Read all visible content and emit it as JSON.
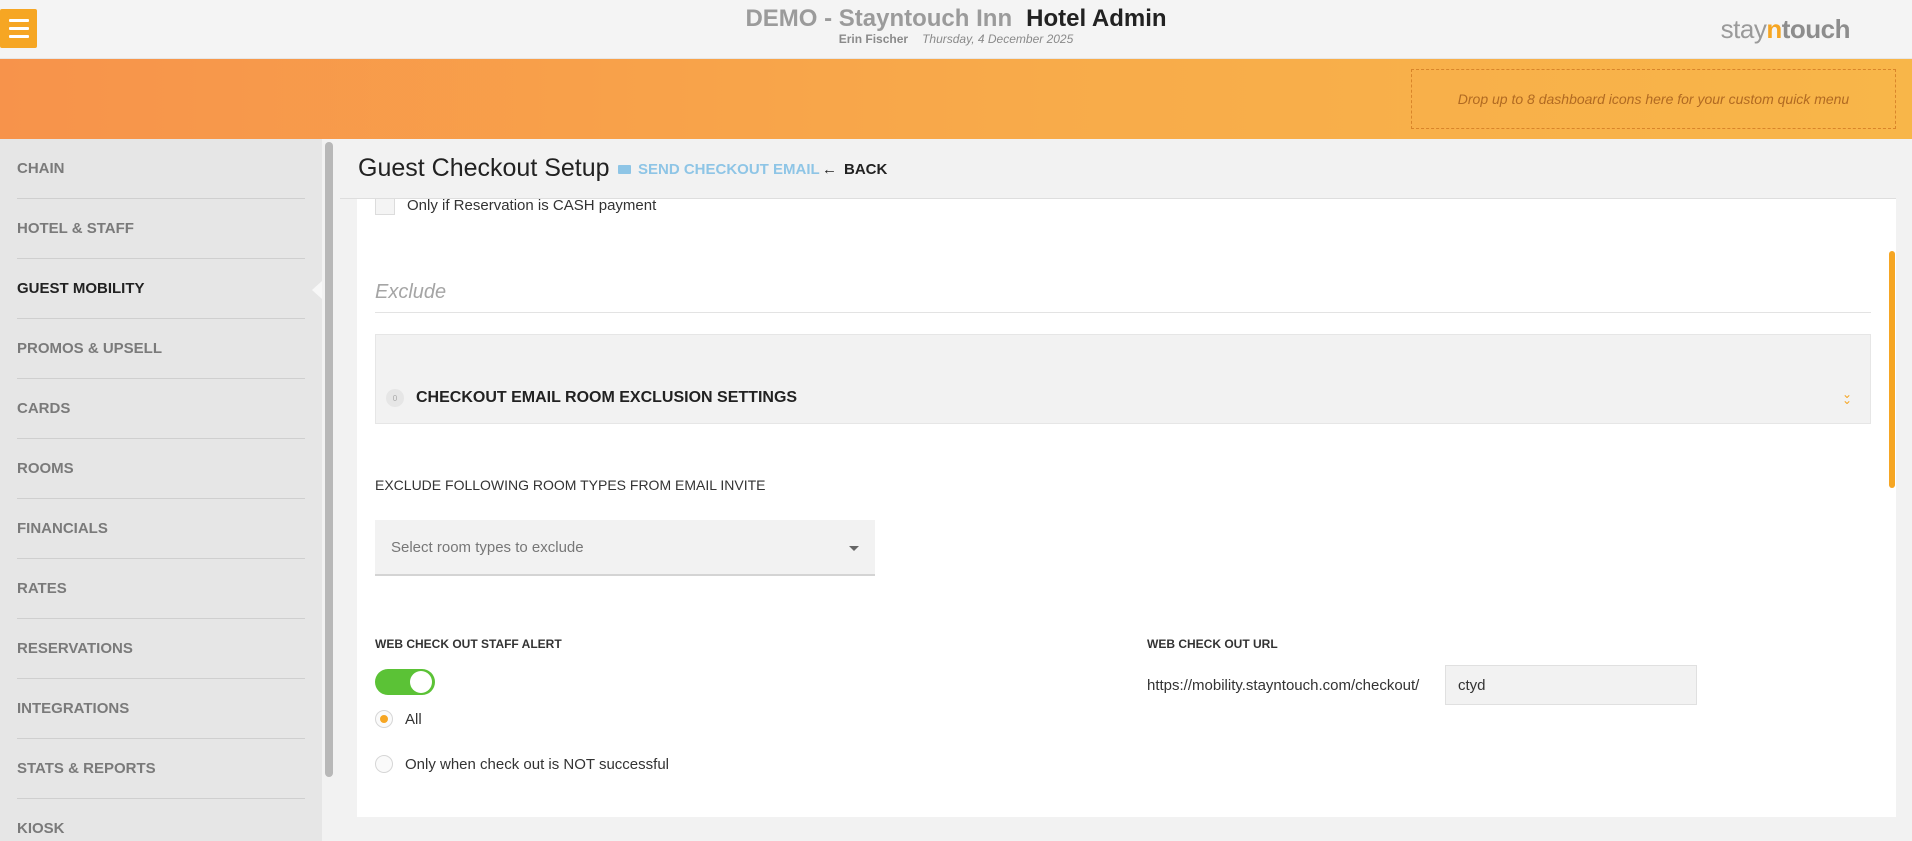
{
  "header": {
    "hotel_name": "DEMO - Stayntouch Inn",
    "app_name": "Hotel Admin",
    "user_name": "Erin Fischer",
    "date": "Thursday, 4 December 2025",
    "logo": {
      "part1": "stay",
      "part2": "n",
      "part3": "touch"
    },
    "menu_icon": "hamburger-icon"
  },
  "quick_menu": {
    "placeholder": "Drop up to 8 dashboard icons here for your custom quick menu"
  },
  "sidebar": {
    "items": [
      {
        "label": "CHAIN"
      },
      {
        "label": "HOTEL & STAFF"
      },
      {
        "label": "GUEST MOBILITY",
        "active": true
      },
      {
        "label": "PROMOS & UPSELL"
      },
      {
        "label": "CARDS"
      },
      {
        "label": "ROOMS"
      },
      {
        "label": "FINANCIALS"
      },
      {
        "label": "RATES"
      },
      {
        "label": "RESERVATIONS"
      },
      {
        "label": "INTEGRATIONS"
      },
      {
        "label": "STATS & REPORTS"
      },
      {
        "label": "KIOSK"
      }
    ]
  },
  "page": {
    "title": "Guest Checkout Setup",
    "send_email_label": "SEND CHECKOUT EMAIL",
    "back_label": "BACK",
    "cash_only_label": "Only if Reservation is CASH payment",
    "exclude_heading": "Exclude",
    "accordion": {
      "count": "0",
      "title": "CHECKOUT EMAIL ROOM EXCLUSION SETTINGS",
      "chevron_icon": "double-chevron-down-icon"
    },
    "exclude_room_types_label": "EXCLUDE FOLLOWING ROOM TYPES FROM EMAIL INVITE",
    "room_types_select": {
      "placeholder": "Select room types to exclude"
    },
    "staff_alert": {
      "label": "WEB CHECK OUT STAFF ALERT",
      "enabled": true,
      "options": [
        {
          "label": "All",
          "selected": true
        },
        {
          "label": "Only when check out is NOT successful",
          "selected": false
        }
      ]
    },
    "checkout_url": {
      "label": "WEB CHECK OUT URL",
      "prefix": "https://mobility.stayntouch.com/checkout/",
      "value": "ctyd"
    }
  },
  "colors": {
    "accent_orange": "#f6a623",
    "toggle_green": "#5bc236",
    "link_blue": "#8ec5e6"
  }
}
